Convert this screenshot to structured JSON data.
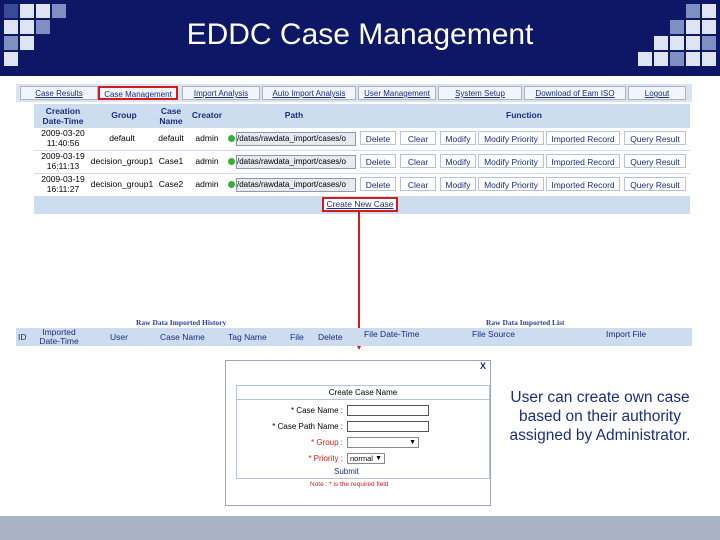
{
  "slide": {
    "title": "EDDC Case Management",
    "callout": "User can create own case based on their authority assigned by Administrator."
  },
  "tabs": [
    {
      "label": "Case Results"
    },
    {
      "label": "Case Management"
    },
    {
      "label": "Import Analysis"
    },
    {
      "label": "Auto Import Analysis"
    },
    {
      "label": "User Management"
    },
    {
      "label": "System Setup"
    },
    {
      "label": "Download of Eam ISO"
    },
    {
      "label": "Logout"
    }
  ],
  "case_table": {
    "headers": {
      "creation": "Creation Date-Time",
      "group": "Group",
      "case_name": "Case Name",
      "creator": "Creator",
      "path": "Path",
      "function": "Function"
    },
    "rows": [
      {
        "date": "2009-03-20",
        "time": "11:40:56",
        "group": "default",
        "case": "default",
        "creator": "admin",
        "path": "/datas/rawdata_import/cases/o"
      },
      {
        "date": "2009-03-19",
        "time": "16:11:13",
        "group": "decision_group1",
        "case": "Case1",
        "creator": "admin",
        "path": "/datas/rawdata_import/cases/o"
      },
      {
        "date": "2009-03-19",
        "time": "16:11:27",
        "group": "decision_group1",
        "case": "Case2",
        "creator": "admin",
        "path": "/datas/rawdata_import/cases/o"
      }
    ],
    "actions": [
      "Delete",
      "Clear",
      "Modify",
      "Modify Priority",
      "Imported Record",
      "Query Result"
    ],
    "create_button": "Create New Case"
  },
  "history": {
    "history_title": "Raw Data Imported History",
    "list_title": "Raw Data Imported List",
    "headers": {
      "id": "ID",
      "imported_date": "Imported Date-Time",
      "user": "User",
      "case_name": "Case Name",
      "tag_name": "Tag Name",
      "file": "File",
      "delete": "Delete",
      "file_date": "File Date-Time",
      "file_source": "File Source",
      "import_file": "Import File"
    }
  },
  "dialog": {
    "close": "X",
    "title": "Create Case Name",
    "fields": {
      "case_name": "* Case Name :",
      "case_path": "* Case Path Name :",
      "group": "* Group :",
      "priority": "* Priority :"
    },
    "priority_value": "normal",
    "submit": "Submit",
    "note": "Note : * is the required field"
  },
  "colors": {
    "title_bg": "#0d1766",
    "accent_red": "#d41a1a",
    "table_bg": "#cddcef",
    "link_blue": "#1a2f80",
    "footer": "#aab3c6"
  }
}
